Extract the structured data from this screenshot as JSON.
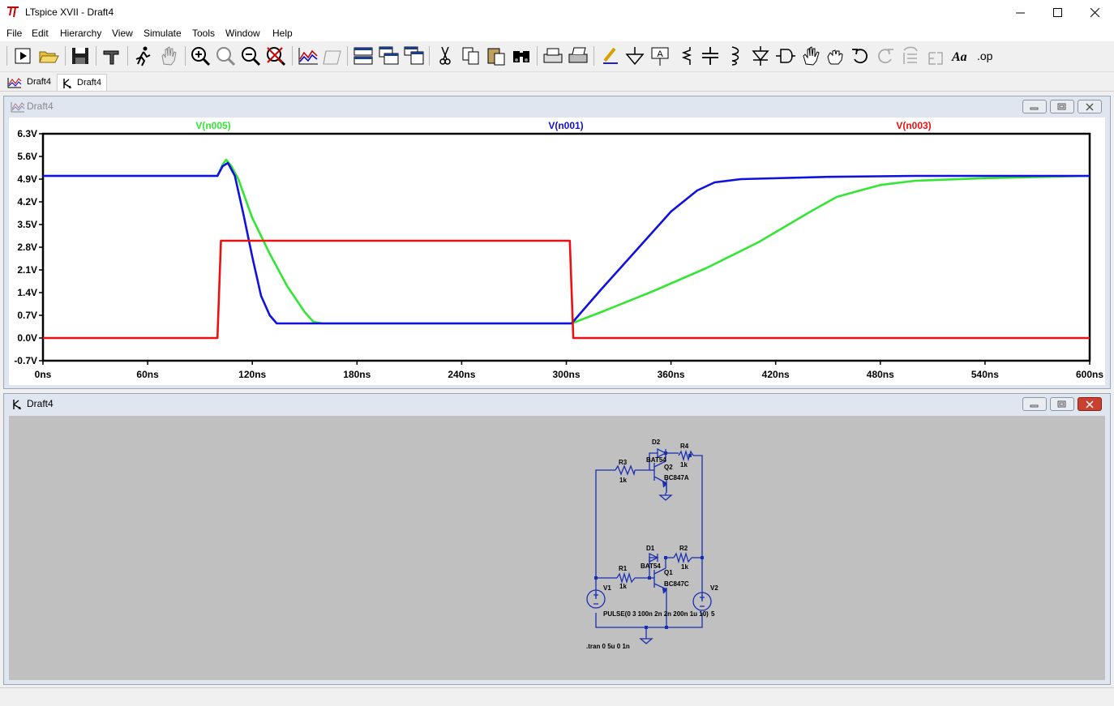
{
  "window": {
    "title": "LTspice XVII - Draft4"
  },
  "menu": [
    "File",
    "Edit",
    "Hierarchy",
    "View",
    "Simulate",
    "Tools",
    "Window",
    "Help"
  ],
  "toolbar": {
    "icons": [
      "run-icon",
      "open-icon",
      "save-icon",
      "control-panel-icon",
      "run-man-icon",
      "pan-hand-icon",
      "zoom-in-icon",
      "zoom-fit-icon",
      "zoom-out-icon",
      "zoom-cancel-icon",
      "waveform-icon",
      "autorange-icon",
      "tile-horizontal-icon",
      "cascade-icon",
      "tile-vertical-icon",
      "cut-icon",
      "copy-icon",
      "paste-icon",
      "find-icon",
      "print-preview-icon",
      "print-icon",
      "wire-icon",
      "ground-icon",
      "label-icon",
      "resistor-icon",
      "capacitor-icon",
      "inductor-icon",
      "diode-icon",
      "component-icon",
      "move-hand-icon",
      "drag-hand-icon",
      "undo-icon",
      "redo-icon",
      "rotate-icon",
      "mirror-icon",
      "text-icon",
      "spice-directive-icon"
    ],
    "text_label": "Aa",
    "op_label": ".op"
  },
  "tabs": [
    {
      "label": "Draft4",
      "icon": "waveform-tab-icon",
      "active": false
    },
    {
      "label": "Draft4",
      "icon": "schematic-tab-icon",
      "active": true
    }
  ],
  "plot_window": {
    "title": "Draft4"
  },
  "schematic_window": {
    "title": "Draft4"
  },
  "chart_data": {
    "type": "line",
    "xlabel": "",
    "ylabel": "",
    "xlim": [
      0,
      600
    ],
    "ylim": [
      -0.7,
      6.3
    ],
    "x_ticks": [
      "0ns",
      "60ns",
      "120ns",
      "180ns",
      "240ns",
      "300ns",
      "360ns",
      "420ns",
      "480ns",
      "540ns",
      "600ns"
    ],
    "x_tick_values": [
      0,
      60,
      120,
      180,
      240,
      300,
      360,
      420,
      480,
      540,
      600
    ],
    "y_ticks": [
      "6.3V",
      "5.6V",
      "4.9V",
      "4.2V",
      "3.5V",
      "2.8V",
      "2.1V",
      "1.4V",
      "0.7V",
      "0.0V",
      "-0.7V"
    ],
    "y_tick_values": [
      6.3,
      5.6,
      4.9,
      4.2,
      3.5,
      2.8,
      2.1,
      1.4,
      0.7,
      0.0,
      -0.7
    ],
    "series": [
      {
        "name": "V(n005)",
        "color": "#33e633",
        "x": [
          0,
          100,
          103,
          105,
          108,
          112,
          120,
          130,
          140,
          150,
          155,
          160,
          200,
          250,
          303,
          320,
          350,
          380,
          410,
          440,
          455,
          465,
          480,
          500,
          540,
          600
        ],
        "y": [
          5.0,
          5.0,
          5.35,
          5.5,
          5.3,
          4.9,
          3.7,
          2.6,
          1.6,
          0.8,
          0.5,
          0.45,
          0.45,
          0.45,
          0.45,
          0.8,
          1.45,
          2.15,
          2.95,
          3.9,
          4.35,
          4.5,
          4.72,
          4.85,
          4.93,
          5.0
        ]
      },
      {
        "name": "V(n001)",
        "color": "#1010e0",
        "x": [
          0,
          100,
          103,
          106,
          110,
          115,
          120,
          125,
          130,
          134,
          140,
          200,
          250,
          303,
          320,
          340,
          360,
          375,
          385,
          400,
          450,
          500,
          600
        ],
        "y": [
          5.0,
          5.0,
          5.3,
          5.4,
          5.0,
          3.8,
          2.5,
          1.3,
          0.7,
          0.45,
          0.45,
          0.45,
          0.45,
          0.45,
          1.5,
          2.7,
          3.9,
          4.55,
          4.8,
          4.9,
          4.97,
          5.0,
          5.0
        ]
      },
      {
        "name": "V(n003)",
        "color": "#ee1010",
        "x": [
          0,
          100,
          102,
          302,
          304,
          600
        ],
        "y": [
          0,
          0,
          3,
          3,
          0,
          0
        ]
      }
    ]
  },
  "schematic": {
    "components": [
      {
        "ref": "D2",
        "value": "BAT54"
      },
      {
        "ref": "R4",
        "value": "1k"
      },
      {
        "ref": "R3",
        "value": "1k"
      },
      {
        "ref": "Q2",
        "value": "BC847A"
      },
      {
        "ref": "D1",
        "value": "BAT54"
      },
      {
        "ref": "R2",
        "value": "1k"
      },
      {
        "ref": "R1",
        "value": "1k"
      },
      {
        "ref": "Q1",
        "value": "BC847C"
      },
      {
        "ref": "V1",
        "value": "PULSE(0 3 100n 2n 2n 200n 1u 10)"
      },
      {
        "ref": "V2",
        "value": "5"
      }
    ],
    "directive": ".tran 0 5u 0 1n"
  }
}
